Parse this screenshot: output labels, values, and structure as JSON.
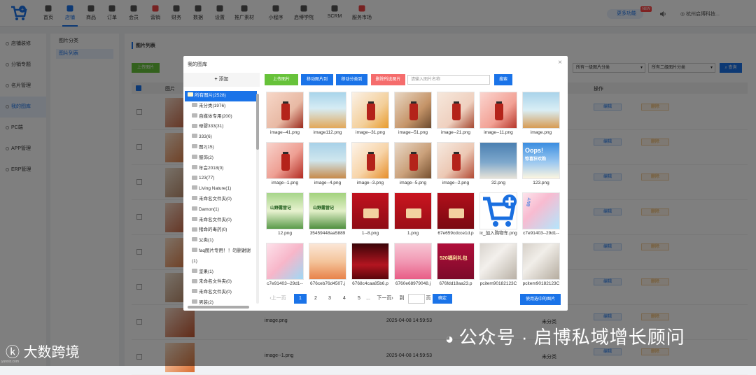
{
  "topnav": {
    "items": [
      {
        "label": "首页",
        "icon": "home-icon"
      },
      {
        "label": "店铺",
        "icon": "store-icon"
      },
      {
        "label": "商品",
        "icon": "goods-icon"
      },
      {
        "label": "订单",
        "icon": "order-icon"
      },
      {
        "label": "会员",
        "icon": "member-icon"
      },
      {
        "label": "营销",
        "icon": "marketing-icon"
      },
      {
        "label": "财务",
        "icon": "finance-icon"
      },
      {
        "label": "数据",
        "icon": "data-icon"
      },
      {
        "label": "设置",
        "icon": "settings-icon"
      },
      {
        "label": "推广素材",
        "icon": "share-icon"
      },
      {
        "label": "小程序",
        "icon": "miniapp-icon"
      },
      {
        "label": "启博学院",
        "icon": "academy-icon"
      },
      {
        "label": "SCRM",
        "icon": "scrm-icon"
      },
      {
        "label": "服务市场",
        "icon": "market-icon"
      }
    ],
    "active_index": 1,
    "more": "更多功能",
    "more_badge": "NEW",
    "company": "杭州启博科技..."
  },
  "side1": {
    "items": [
      "店铺装修",
      "分销专题",
      "名片管理",
      "我的图库",
      "PC端",
      "APP管理",
      "ERP管理"
    ],
    "active_index": 3
  },
  "side2": {
    "items": [
      "图片分类",
      "图片列表"
    ],
    "active_index": 1
  },
  "main": {
    "title": "图片列表",
    "upload": "上传图片",
    "select1": "所有一级图片分类",
    "select2": "所有二级图片分类",
    "query": "查询",
    "header_image": "图片",
    "header_action": "操作",
    "edit": "编辑",
    "delete": "删除",
    "rows": [
      {
        "name": "image.png",
        "time": "2025-04-08 14:59:53",
        "category": "未分类"
      },
      {
        "name": "image--1.png",
        "time": "2025-04-08 14:59:53",
        "category": "未分类"
      }
    ]
  },
  "modal": {
    "title": "我的图库",
    "add": "添加",
    "buttons": {
      "upload": "上传图片",
      "move_group": "移动图片到",
      "move_cat": "移动分类到",
      "delete_selected": "删除所选图片"
    },
    "search_placeholder": "请输入图片名称",
    "search_btn": "搜索",
    "tree": [
      "所有图片(2528)",
      "未分类(1976)",
      "自媒体专用(200)",
      "母婴333(31)",
      "333(6)",
      "图2(15)",
      "服饰(2)",
      "年会2018(0)",
      "123(77)",
      "Living Nature(1)",
      "未命名文件夹(0)",
      "Damon(1)",
      "未命名文件夹(0)",
      "猪命的毒药(0)",
      "父类(1)",
      "faq图片专用！！勿删谢谢",
      "(1)",
      "坚果(1)",
      "未命名文件夹(0)",
      "未命名文件夹(0)",
      "男装(2)"
    ],
    "tree_selected": 0,
    "images": [
      "image--41.png",
      "image112.png",
      "image--31.png",
      "image--51.png",
      "image--21.png",
      "image--11.png",
      "image.png",
      "image--1.png",
      "image--4.png",
      "image--3.png",
      "image--5.png",
      "image--2.png",
      "32.png",
      "123.png",
      "12.png",
      "35459448aa5889",
      "1--8.png",
      "1.png",
      "67e659cdcce1d.p",
      "ic_加入购物车.png",
      "c7e91403--29d1--",
      "c7e91403--29d1--",
      "676ceb76d4507.j",
      "6768c4caa85b6.p",
      "6760e68979048.j",
      "676fdd18aa23.p",
      "pcitem90182123C",
      "pcitem90182123C"
    ],
    "pager": {
      "prev": "上一页",
      "pages": [
        "1",
        "2",
        "3",
        "4",
        "5"
      ],
      "dots": "...",
      "next": "下一页",
      "to": "到",
      "page": "页",
      "confirm": "确定"
    },
    "use_selected": "使用选中的图片"
  },
  "banner_texts": {
    "oops": "Oops!",
    "discount": "惊喜狂欢购",
    "mountain": "山野露营记",
    "promo": "520福利礼包",
    "buy": "BUY"
  },
  "watermark": {
    "wechat": "公众号 · 启博私域增长顾问",
    "brand": "大数跨境",
    "url": "yunxiz.com"
  },
  "colors": {
    "primary": "#1a73e8",
    "green": "#67c23a",
    "red": "#f56c6c",
    "orange": "#e6a23c"
  }
}
